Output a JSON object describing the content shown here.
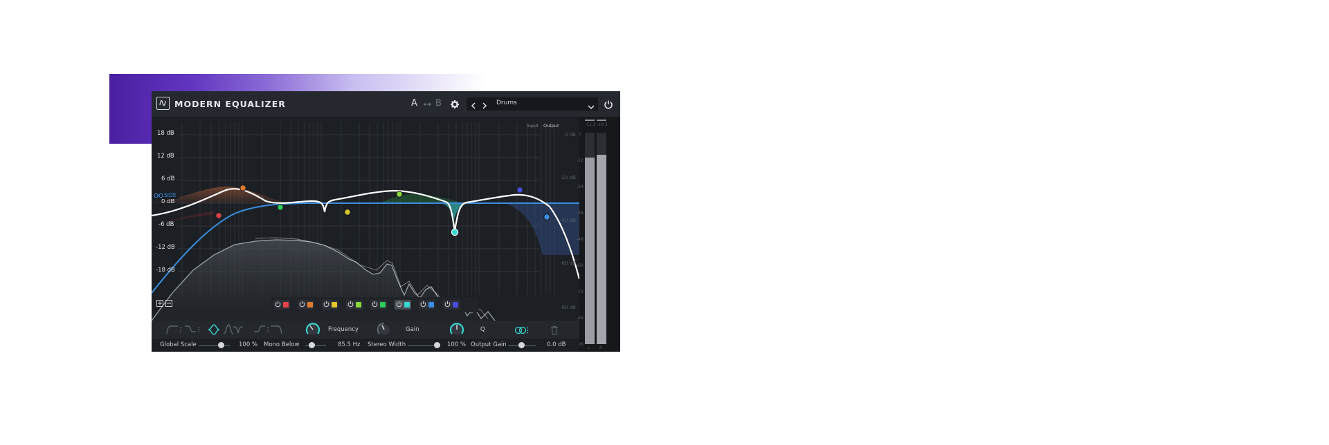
{
  "plugin": {
    "title": "MODERN EQUALIZER",
    "ab": {
      "a": "A",
      "b": "B",
      "copy_icon": "ab-copy-icon"
    },
    "preset_name": "Drums"
  },
  "meter_header": {
    "input": "Input",
    "output": "Output"
  },
  "gain_scale": [
    "18 dB",
    "12 dB",
    "6 dB",
    "0 dB",
    "-6 dB",
    "-12 dB",
    "-18 dB"
  ],
  "output_scale": [
    "0 dB",
    "-20 dB",
    "-40 dB",
    "-60 dB",
    "-80 dB"
  ],
  "side_label": "SIDE",
  "meter": {
    "peaks": [
      "-11.3",
      "-10.3"
    ],
    "ticks": [
      "0",
      "-12",
      "-24",
      "-36",
      "-48",
      "-60",
      "-72",
      "-84",
      "-96"
    ],
    "channels": [
      "L",
      "R"
    ]
  },
  "bands": [
    {
      "color": "#e8434c"
    },
    {
      "color": "#e07a2e"
    },
    {
      "color": "#e2c62a"
    },
    {
      "color": "#8ad83b"
    },
    {
      "color": "#2ecc5a"
    },
    {
      "color": "#38d6d0"
    },
    {
      "color": "#3a8ee0"
    },
    {
      "color": "#4a4de0"
    }
  ],
  "controls": {
    "frequency": "Frequency",
    "gain": "Gain",
    "q": "Q"
  },
  "bottom": {
    "global_scale_label": "Global Scale",
    "global_scale_value": "100 %",
    "mono_below_label": "Mono Below",
    "mono_below_value": "85.5 Hz",
    "stereo_width_label": "Stereo Width",
    "stereo_width_value": "100 %",
    "output_gain_label": "Output Gain",
    "output_gain_value": "0.0 dB"
  },
  "colors": {
    "accent_teal": "#38d6d0",
    "side_blue": "#3a8ee0"
  }
}
